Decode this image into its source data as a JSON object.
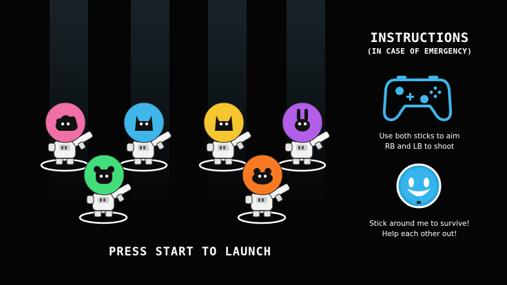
{
  "screen": {
    "prompt": "PRESS START TO LAUNCH"
  },
  "instructions": {
    "title": "INSTRUCTIONS",
    "subtitle": "(IN CASE OF EMERGENCY)",
    "controls_line1": "Use both sticks to aim",
    "controls_line2": "RB and LB to shoot",
    "tip_line1": "Stick around me to survive!",
    "tip_line2": "Help each other out!"
  },
  "players": [
    {
      "id": "pink",
      "helmet_color": "#f06fa6",
      "creature": "blob"
    },
    {
      "id": "blue",
      "helmet_color": "#3fb6ea",
      "creature": "cat"
    },
    {
      "id": "green",
      "helmet_color": "#42de7b",
      "creature": "bear"
    },
    {
      "id": "yellow",
      "helmet_color": "#f5c630",
      "creature": "cat"
    },
    {
      "id": "purple",
      "helmet_color": "#b25ee8",
      "creature": "bunny"
    },
    {
      "id": "orange",
      "helmet_color": "#f77a22",
      "creature": "frog"
    }
  ],
  "icons": {
    "controller": "gamepad-icon",
    "companion": "smiley-robot-icon",
    "accent_color": "#3fb6ea"
  }
}
